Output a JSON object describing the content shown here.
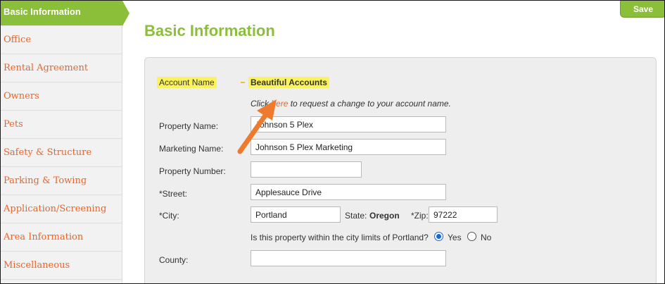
{
  "sidebar": {
    "items": [
      {
        "label": "Basic Information",
        "active": true
      },
      {
        "label": "Office"
      },
      {
        "label": "Rental Agreement"
      },
      {
        "label": "Owners"
      },
      {
        "label": "Pets"
      },
      {
        "label": "Safety & Structure"
      },
      {
        "label": "Parking & Towing"
      },
      {
        "label": "Application/Screening"
      },
      {
        "label": "Area Information"
      },
      {
        "label": "Miscellaneous"
      }
    ]
  },
  "toolbar": {
    "save_label": "Save"
  },
  "page": {
    "title": "Basic Information"
  },
  "form": {
    "account_name_label": "Account Name",
    "account_name_value": "Beautiful Accounts",
    "change_note_prefix": "Click",
    "change_note_link": "here",
    "change_note_suffix": "to request a change to your account name.",
    "property_name_label": "Property Name:",
    "property_name_value": "Johnson 5 Plex",
    "marketing_name_label": "Marketing Name:",
    "marketing_name_value": "Johnson 5 Plex Marketing",
    "property_number_label": "Property Number:",
    "property_number_value": "",
    "street_label": "*Street:",
    "street_value": "Applesauce Drive",
    "city_label": "*City:",
    "city_value": "Portland",
    "state_label": "State:",
    "state_value": "Oregon",
    "zip_label": "*Zip:",
    "zip_value": "97222",
    "city_limits_question": "Is this property within the city limits of Portland?",
    "yes_label": "Yes",
    "no_label": "No",
    "city_limits_selected": "Yes",
    "county_label": "County:",
    "county_value": ""
  },
  "colors": {
    "accent_green": "#8bbf3a",
    "link_orange": "#e8652a",
    "highlight_yellow": "#fbf35c",
    "annotation_arrow": "#ee7a2e"
  }
}
